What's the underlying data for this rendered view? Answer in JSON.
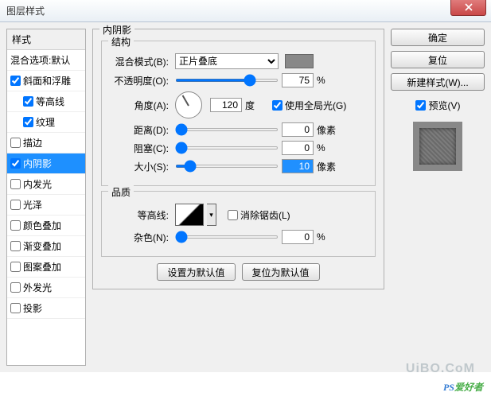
{
  "window": {
    "title": "图层样式"
  },
  "styles_panel": {
    "header": "样式",
    "items": [
      {
        "label": "混合选项:默认",
        "checkbox": false,
        "checked": false,
        "indent": false
      },
      {
        "label": "斜面和浮雕",
        "checkbox": true,
        "checked": true,
        "indent": false
      },
      {
        "label": "等高线",
        "checkbox": true,
        "checked": true,
        "indent": true
      },
      {
        "label": "纹理",
        "checkbox": true,
        "checked": true,
        "indent": true
      },
      {
        "label": "描边",
        "checkbox": true,
        "checked": false,
        "indent": false
      },
      {
        "label": "内阴影",
        "checkbox": true,
        "checked": true,
        "indent": false,
        "selected": true
      },
      {
        "label": "内发光",
        "checkbox": true,
        "checked": false,
        "indent": false
      },
      {
        "label": "光泽",
        "checkbox": true,
        "checked": false,
        "indent": false
      },
      {
        "label": "颜色叠加",
        "checkbox": true,
        "checked": false,
        "indent": false
      },
      {
        "label": "渐变叠加",
        "checkbox": true,
        "checked": false,
        "indent": false
      },
      {
        "label": "图案叠加",
        "checkbox": true,
        "checked": false,
        "indent": false
      },
      {
        "label": "外发光",
        "checkbox": true,
        "checked": false,
        "indent": false
      },
      {
        "label": "投影",
        "checkbox": true,
        "checked": false,
        "indent": false
      }
    ]
  },
  "main_group": {
    "title": "内阴影",
    "structure": {
      "title": "结构",
      "blend_mode": {
        "label": "混合模式(B):",
        "value": "正片叠底"
      },
      "opacity": {
        "label": "不透明度(O):",
        "value": "75",
        "unit": "%"
      },
      "angle": {
        "label": "角度(A):",
        "value": "120",
        "unit": "度",
        "global_label": "使用全局光(G)",
        "global_checked": true
      },
      "distance": {
        "label": "距离(D):",
        "value": "0",
        "unit": "像素"
      },
      "choke": {
        "label": "阻塞(C):",
        "value": "0",
        "unit": "%"
      },
      "size": {
        "label": "大小(S):",
        "value": "10",
        "unit": "像素"
      }
    },
    "quality": {
      "title": "品质",
      "contour": {
        "label": "等高线:",
        "antialias_label": "消除锯齿(L)",
        "antialias_checked": false
      },
      "noise": {
        "label": "杂色(N):",
        "value": "0",
        "unit": "%"
      }
    },
    "defaults": {
      "make_default": "设置为默认值",
      "reset_default": "复位为默认值"
    }
  },
  "right": {
    "ok": "确定",
    "reset": "复位",
    "new_style": "新建样式(W)...",
    "preview_label": "预览(V)",
    "preview_checked": true
  },
  "watermark": {
    "url": "UiBO.CoM",
    "text1": "PS",
    "text2": "爱好者"
  }
}
